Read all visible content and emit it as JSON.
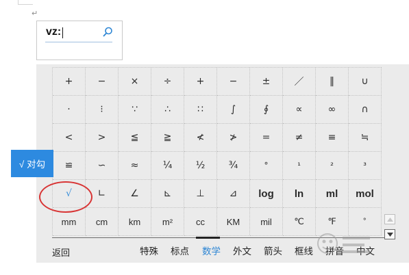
{
  "input": {
    "value": "vz:",
    "icon": "search-icon"
  },
  "side_tag": {
    "label": "√ 对勾"
  },
  "symbols": [
    [
      "+",
      "−",
      "×",
      "÷",
      "+",
      "−",
      "±",
      "／",
      "‖",
      "∪"
    ],
    [
      "·",
      "⁝",
      "∵",
      "∴",
      "∷",
      "∫",
      "∮",
      "∝",
      "∞",
      "∩"
    ],
    [
      "<",
      ">",
      "≦",
      "≧",
      "≮",
      "≯",
      "=",
      "≠",
      "≡",
      "≒"
    ],
    [
      "≌",
      "∽",
      "≈",
      "¼",
      "½",
      "¾",
      "°",
      "¹",
      "²",
      "³"
    ],
    [
      "√",
      "∟",
      "∠",
      "⊾",
      "⊥",
      "⊿",
      "log",
      "ln",
      "ml",
      "mol"
    ],
    [
      "mm",
      "cm",
      "km",
      "m²",
      "cc",
      "KM",
      "mil",
      "℃",
      "℉",
      "˚"
    ]
  ],
  "footer": {
    "back_label": "返回",
    "tabs": [
      "特殊",
      "标点",
      "数学",
      "外文",
      "箭头",
      "框线",
      "拼音",
      "中文"
    ],
    "active_tab": "数学"
  },
  "colors": {
    "accent": "#2d8ae0",
    "active_tab": "#2e86d4",
    "annotation": "#d83434",
    "panel_bg": "#ebebeb"
  }
}
